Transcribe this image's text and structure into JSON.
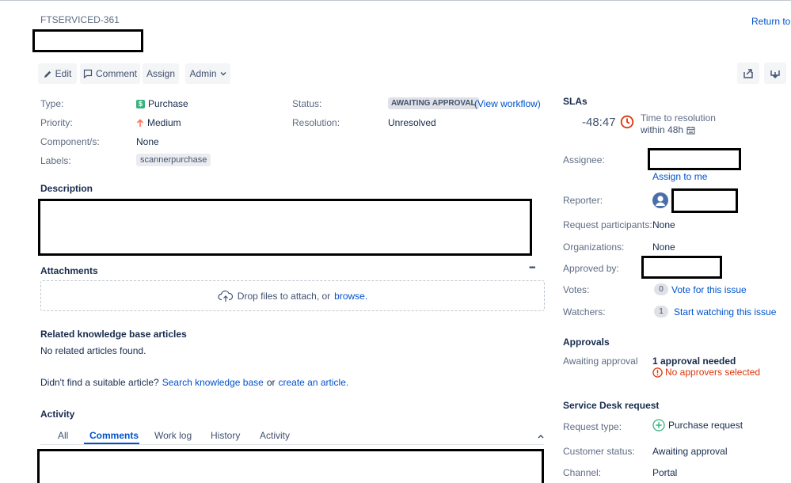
{
  "issue": {
    "key": "FTSERVICED-361",
    "return_link": "Return to s"
  },
  "toolbar": {
    "edit": "Edit",
    "comment": "Comment",
    "assign": "Assign",
    "admin": "Admin"
  },
  "details": {
    "type_label": "Type:",
    "type_value": "Purchase",
    "type_icon_glyph": "$",
    "priority_label": "Priority:",
    "priority_value": "Medium",
    "components_label": "Component/s:",
    "components_value": "None",
    "labels_label": "Labels:",
    "labels_value": "scannerpurchase",
    "status_label": "Status:",
    "status_value": "AWAITING APPROVAL",
    "status_link": "(View workflow)",
    "resolution_label": "Resolution:",
    "resolution_value": "Unresolved"
  },
  "description": {
    "heading": "Description"
  },
  "attachments": {
    "heading": "Attachments",
    "more": "•••",
    "drop_text": "Drop files to attach, or",
    "browse": "browse."
  },
  "kb": {
    "heading": "Related knowledge base articles",
    "empty": "No related articles found.",
    "prompt": "Didn't find a suitable article?",
    "search_link": "Search knowledge base",
    "or": "or",
    "create_link": "create an article."
  },
  "activity": {
    "heading": "Activity",
    "tabs": [
      "All",
      "Comments",
      "Work log",
      "History",
      "Activity"
    ],
    "active_tab": "Comments",
    "collapse": "^"
  },
  "sla": {
    "heading": "SLAs",
    "time": "-48:47",
    "name": "Time to resolution",
    "goal": "within 48h"
  },
  "people": {
    "assignee_label": "Assignee:",
    "assign_to_me": "Assign to me",
    "reporter_label": "Reporter:",
    "participants_label": "Request participants:",
    "participants_value": "None",
    "organizations_label": "Organizations:",
    "organizations_value": "None",
    "approved_by_label": "Approved by:",
    "votes_label": "Votes:",
    "votes_count": "0",
    "vote_link": "Vote for this issue",
    "watchers_label": "Watchers:",
    "watchers_count": "1",
    "watch_link": "Start watching this issue"
  },
  "approvals": {
    "heading": "Approvals",
    "label": "Awaiting approval",
    "needed": "1 approval needed",
    "warning": "No approvers selected"
  },
  "service_desk": {
    "heading": "Service Desk request",
    "request_type_label": "Request type:",
    "request_type_value": "Purchase request",
    "customer_status_label": "Customer status:",
    "customer_status_value": "Awaiting approval",
    "channel_label": "Channel:",
    "channel_value": "Portal"
  },
  "colors": {
    "link": "#0052cc",
    "sla_breached": "#de350b",
    "error": "#de350b",
    "purchase_green": "#36b37e",
    "priority_orange": "#ff7452",
    "request_type_green": "#36b37e"
  },
  "icons": {
    "edit": "pencil-icon",
    "comment": "comment-icon",
    "admin_dropdown": "chevron-down-icon",
    "share": "share-icon",
    "export": "export-icon",
    "type": "purchase-icon",
    "priority": "arrow-up-icon",
    "sla_clock": "clock-icon",
    "calendar": "calendar-icon",
    "reporter_avatar": "user-avatar-icon",
    "upload": "cloud-upload-icon",
    "error": "error-icon",
    "request_type": "plus-circle-icon"
  }
}
